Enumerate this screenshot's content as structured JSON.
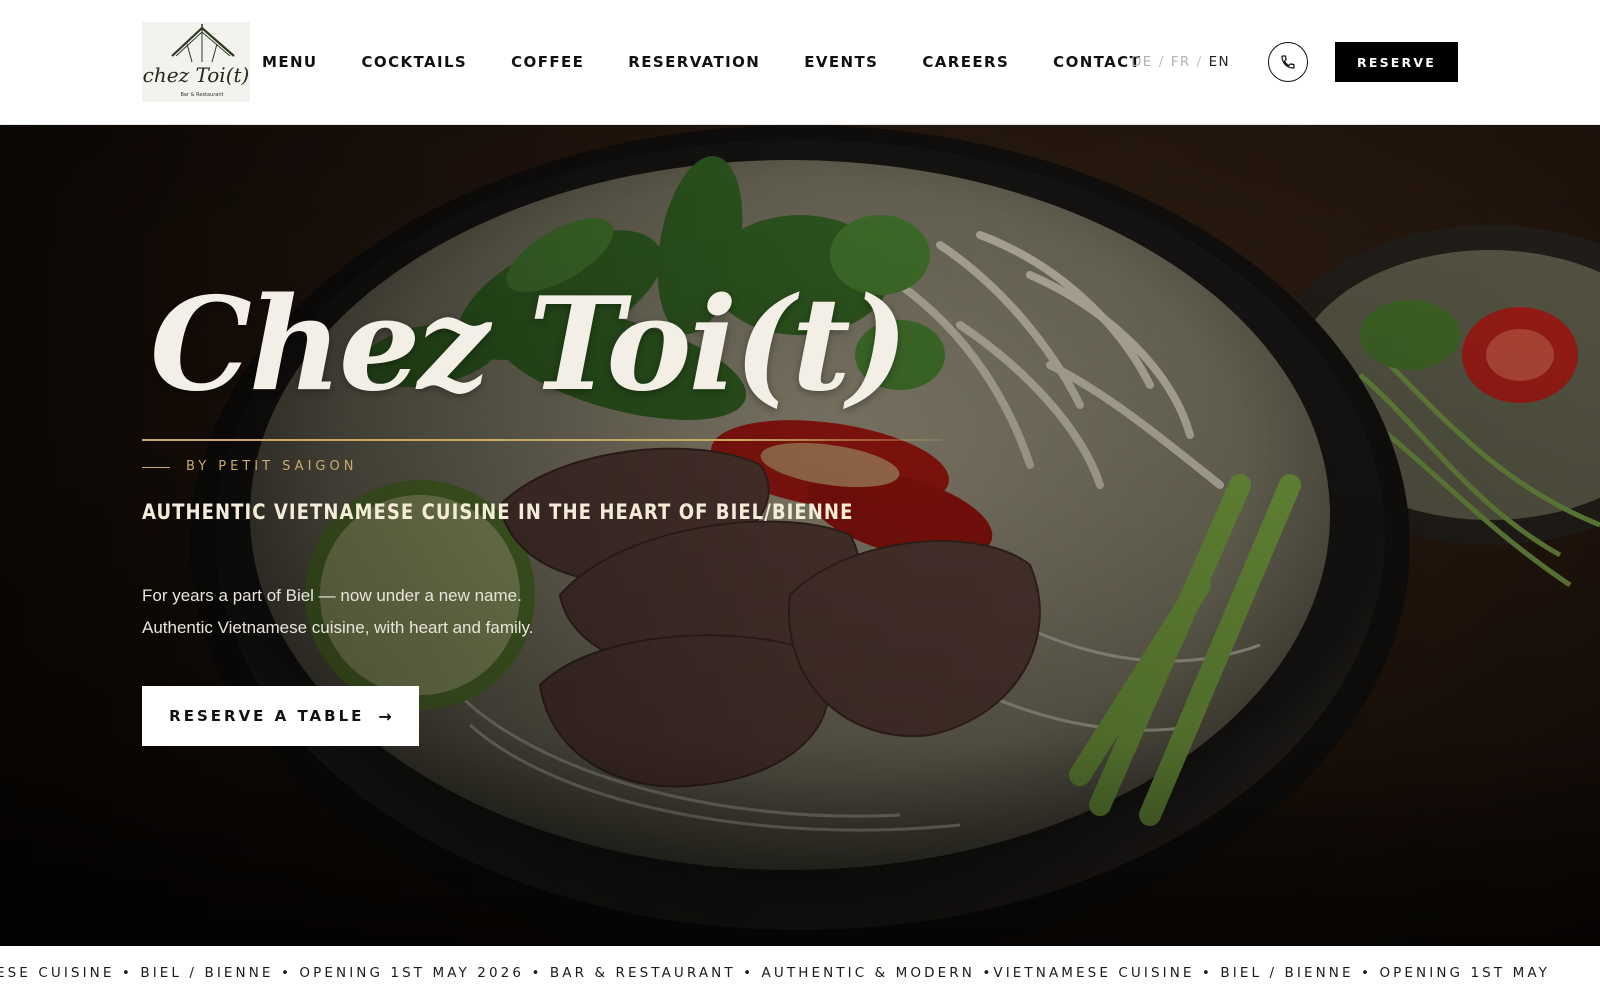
{
  "header": {
    "logo": {
      "text_main": "chez Toi(t)",
      "text_sub": "Bar & Restaurant"
    },
    "nav": [
      "MENU",
      "COCKTAILS",
      "COFFEE",
      "RESERVATION",
      "EVENTS",
      "CAREERS",
      "CONTACT"
    ],
    "languages": [
      {
        "label": "DE",
        "active": false
      },
      {
        "label": "FR",
        "active": false
      },
      {
        "label": "EN",
        "active": true
      }
    ],
    "language_separator": "/",
    "phone_icon": "phone-icon",
    "reserve_label": "RESERVE"
  },
  "hero": {
    "title": "Chez Toi(t)",
    "byline": "BY PETIT SAIGON",
    "tagline": "AUTHENTIC VIETNAMESE CUISINE IN THE HEART OF BIEL/BIENNE",
    "description": [
      "For years a part of Biel — now under a new name.",
      "Authentic Vietnamese cuisine, with heart and family."
    ],
    "cta_label": "RESERVE A TABLE",
    "cta_arrow": "→"
  },
  "ticker": {
    "text": "ESE CUISINE • BIEL / BIENNE • OPENING 1ST MAY 2026 • BAR & RESTAURANT • AUTHENTIC & MODERN •VIETNAMESE CUISINE • BIEL / BIENNE • OPENING 1ST MAY"
  },
  "colors": {
    "accent_gold": "#c9ab6e",
    "header_bg": "#ffffff",
    "button_dark": "#000000"
  }
}
